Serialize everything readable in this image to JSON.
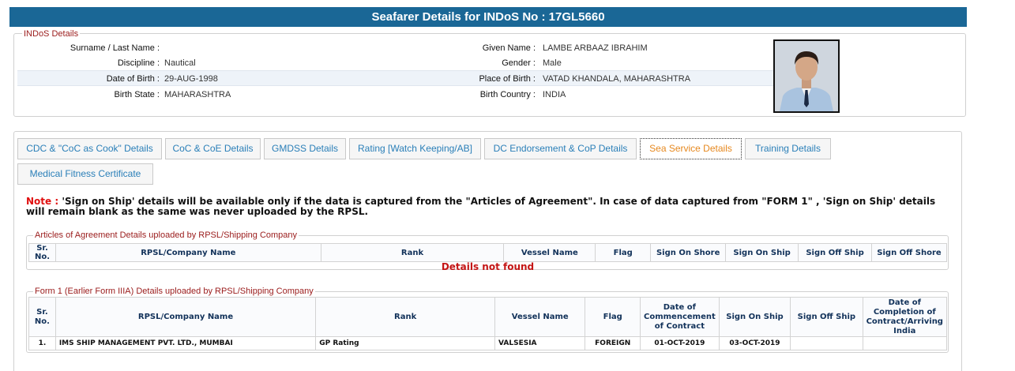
{
  "title": "Seafarer Details for INDoS No : 17GL5660",
  "indos": {
    "legend": "INDoS Details",
    "rows": [
      {
        "label1": "Surname / Last Name :",
        "value1": "",
        "label2": "Given Name :",
        "value2": "LAMBE ARBAAZ IBRAHIM"
      },
      {
        "label1": "Discipline :",
        "value1": "Nautical",
        "label2": "Gender :",
        "value2": "Male"
      },
      {
        "label1": "Date of Birth :",
        "value1": "29-AUG-1998",
        "label2": "Place of Birth :",
        "value2": "VATAD KHANDALA, MAHARASHTRA"
      },
      {
        "label1": "Birth State :",
        "value1": "MAHARASHTRA",
        "label2": "Birth Country :",
        "value2": "INDIA"
      }
    ]
  },
  "tabs": [
    "CDC & \"CoC as Cook\" Details",
    "CoC & CoE Details",
    "GMDSS Details",
    "Rating [Watch Keeping/AB]",
    "DC Endorsement & CoP Details",
    "Sea Service Details",
    "Training Details",
    "Medical Fitness Certificate"
  ],
  "note": {
    "label": "Note :",
    "text": " 'Sign on Ship' details will be available only if the data is captured from the \"Articles of Agreement\". In case of data captured from \"FORM 1\" , 'Sign on Ship' details will remain blank as the same was never uploaded by the RPSL."
  },
  "aoa": {
    "legend": "Articles of Agreement Details uploaded by RPSL/Shipping Company",
    "headers": [
      "Sr. No.",
      "RPSL/Company Name",
      "Rank",
      "Vessel Name",
      "Flag",
      "Sign On Shore",
      "Sign On Ship",
      "Sign Off Ship",
      "Sign Off Shore"
    ],
    "not_found": "Details not found"
  },
  "form1": {
    "legend": "Form 1 (Earlier Form IIIA) Details uploaded by RPSL/Shipping Company",
    "headers": [
      "Sr. No.",
      "RPSL/Company Name",
      "Rank",
      "Vessel Name",
      "Flag",
      "Date of Commencement of Contract",
      "Sign On Ship",
      "Sign Off Ship",
      "Date of Completion of Contract/Arriving India"
    ],
    "rows": [
      [
        "1.",
        "IMS SHIP MANAGEMENT PVT. LTD., MUMBAI",
        "GP Rating",
        "VALSESIA",
        "FOREIGN",
        "01-OCT-2019",
        "03-OCT-2019",
        "",
        ""
      ]
    ]
  }
}
